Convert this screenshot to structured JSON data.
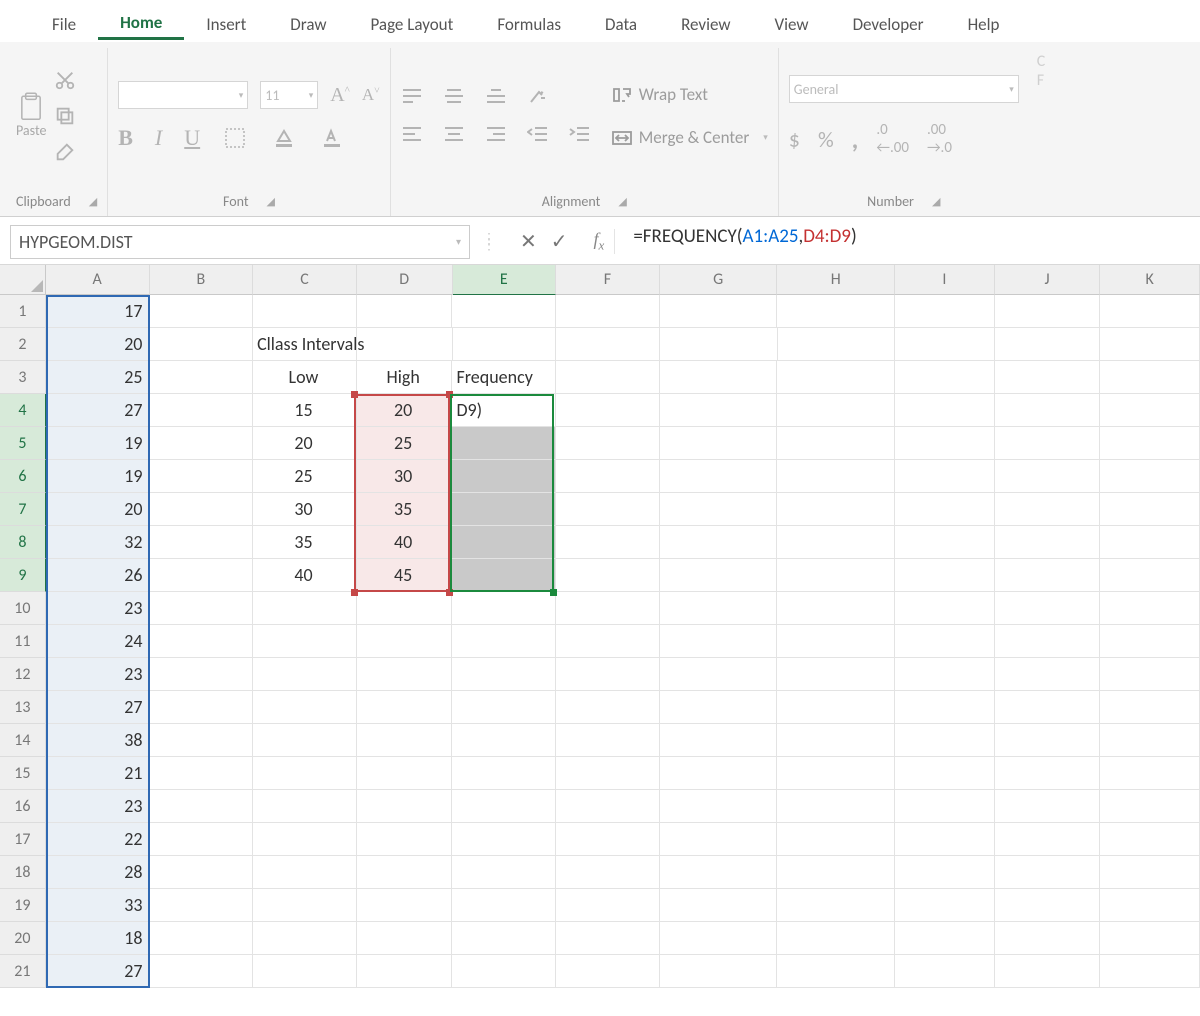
{
  "tabs": {
    "file": "File",
    "home": "Home",
    "insert": "Insert",
    "draw": "Draw",
    "pageLayout": "Page Layout",
    "formulas": "Formulas",
    "data": "Data",
    "review": "Review",
    "view": "View",
    "developer": "Developer",
    "help": "Help"
  },
  "clipboard": {
    "pasteLabel": "Paste",
    "groupLabel": "Clipboard"
  },
  "font": {
    "nameValue": "",
    "sizeValue": "11",
    "groupLabel": "Font",
    "boldLabel": "B",
    "italicLabel": "I",
    "underlineLabel": "U",
    "growLabel": "A^",
    "shrinkLabel": "A˅"
  },
  "alignment": {
    "wrapLabel": "Wrap Text",
    "mergeLabel": "Merge & Center",
    "groupLabel": "Alignment"
  },
  "number": {
    "formatValue": "General",
    "groupLabel": "Number"
  },
  "namebox": {
    "value": "HYPGEOM.DIST"
  },
  "formula": {
    "prefix": "=FREQUENCY(",
    "arg1": "A1:A25",
    "comma": ",",
    "arg2": "D4:D9",
    "suffix": ")"
  },
  "cellEditText": "D9)",
  "headers": {
    "classIntervals": "Cllass Intervals",
    "low": "Low",
    "high": "High",
    "frequency": "Frequency"
  },
  "colA": [
    "17",
    "20",
    "25",
    "27",
    "19",
    "19",
    "20",
    "32",
    "26",
    "23",
    "24",
    "23",
    "27",
    "38",
    "21",
    "23",
    "22",
    "28",
    "33",
    "18",
    "27"
  ],
  "colC": [
    "15",
    "20",
    "25",
    "30",
    "35",
    "40"
  ],
  "colD": [
    "20",
    "25",
    "30",
    "35",
    "40",
    "45"
  ],
  "columns": [
    "A",
    "B",
    "C",
    "D",
    "E",
    "F",
    "G",
    "H",
    "I",
    "J",
    "K"
  ]
}
